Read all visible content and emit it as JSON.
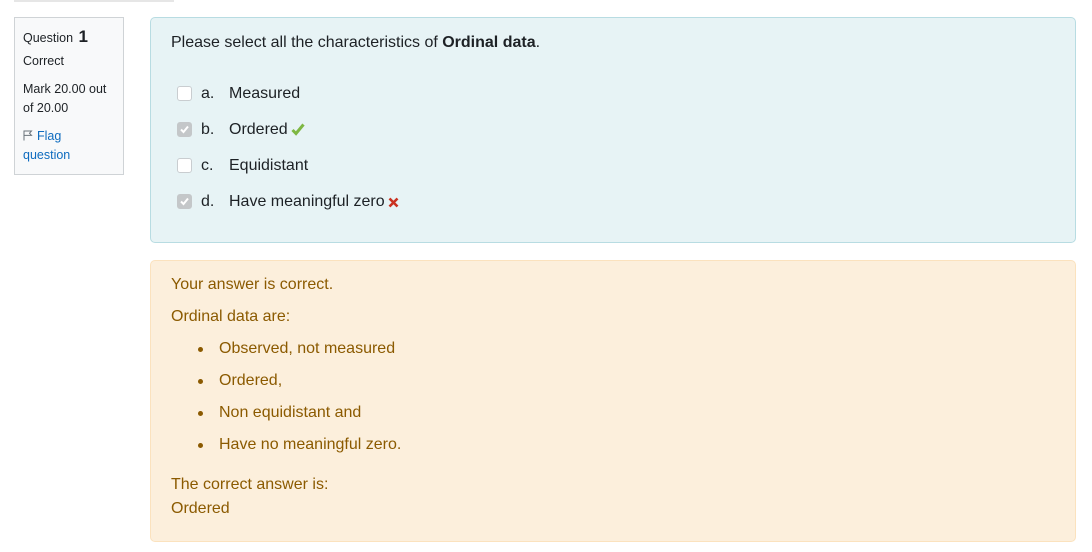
{
  "info": {
    "question_label": "Question",
    "question_number": "1",
    "state": "Correct",
    "grade_line1": "Mark 20.00 out",
    "grade_line2": "of 20.00",
    "flag_line1": "Flag",
    "flag_line2": "question"
  },
  "question": {
    "text_prefix": "Please select all the characteristics of ",
    "text_bold": "Ordinal data",
    "text_suffix": ".",
    "options": [
      {
        "letter": "a.",
        "label": "Measured",
        "checked": false,
        "mark": "none"
      },
      {
        "letter": "b.",
        "label": "Ordered",
        "checked": true,
        "mark": "check-icon"
      },
      {
        "letter": "c.",
        "label": "Equidistant",
        "checked": false,
        "mark": "none"
      },
      {
        "letter": "d.",
        "label": "Have meaningful zero",
        "checked": true,
        "mark": "cross-icon"
      }
    ]
  },
  "feedback": {
    "status": "Your answer is correct.",
    "intro": "Ordinal data are:",
    "points": [
      "Observed, not measured",
      "Ordered,",
      "Non equidistant and",
      "Have no meaningful zero."
    ],
    "right_answer_label": "The correct answer is:",
    "right_answer": "Ordered"
  },
  "colors": {
    "correct": "#7eb742",
    "incorrect": "#ca3120",
    "link": "#0f6cbf",
    "feedback_text": "#8b5a00"
  }
}
